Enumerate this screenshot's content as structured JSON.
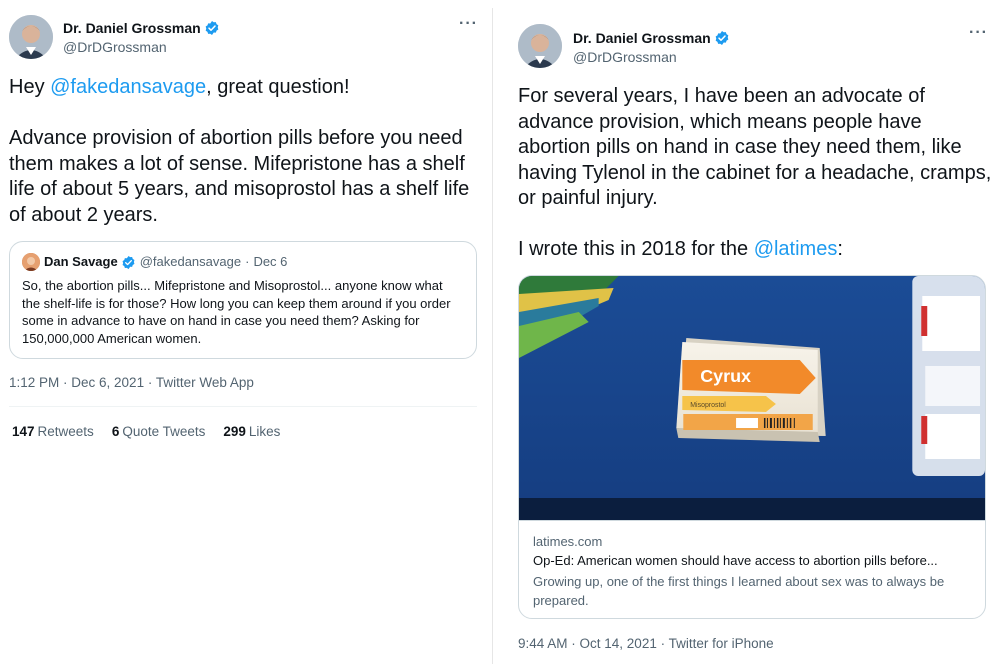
{
  "left_tweet": {
    "author": {
      "display_name": "Dr. Daniel Grossman",
      "handle": "@DrDGrossman",
      "verified": true
    },
    "more_icon": "more-horizontal-icon",
    "text": {
      "greeting": "Hey ",
      "mention": "@fakedansavage",
      "greeting_rest": ", great question!",
      "paragraph": "Advance provision of abortion pills before you need them makes a lot of sense. Mifepristone has a shelf life of about 5 years, and misoprostol has a shelf life of about 2 years."
    },
    "quoted_tweet": {
      "display_name": "Dan Savage",
      "handle": "@fakedansavage",
      "separator": "·",
      "date": "Dec 6",
      "text": "So, the abortion pills... Mifepristone and Misoprostol... anyone know what the shelf-life is for those? How long you can keep them around if you order some in advance to have on hand in case you need them? Asking for 150,000,000 American women."
    },
    "timestamp": "1:12 PM · Dec 6, 2021 · Twitter Web App",
    "stats": {
      "retweets_count": "147",
      "retweets_label": "Retweets",
      "quotes_count": "6",
      "quotes_label": "Quote Tweets",
      "likes_count": "299",
      "likes_label": "Likes"
    }
  },
  "right_tweet": {
    "author": {
      "display_name": "Dr. Daniel Grossman",
      "handle": "@DrDGrossman",
      "verified": true
    },
    "more_icon": "more-horizontal-icon",
    "text": {
      "paragraph1": "For several years, I have been an advocate of advance provision, which means people have abortion pills on hand in case they need them, like having Tylenol in the cabinet for a headache, cramps, or painful injury.",
      "paragraph2_prefix": "I wrote this in 2018 for the ",
      "mention": "@latimes",
      "paragraph2_suffix": ":"
    },
    "link_card": {
      "image_brand": "Cyrux",
      "image_subtext": "Misoprostol",
      "domain": "latimes.com",
      "title": "Op-Ed: American women should have access to abortion pills before...",
      "description": "Growing up, one of the first things I learned about sex was to always be prepared."
    },
    "timestamp": "9:44 AM · Oct 14, 2021 · Twitter for iPhone"
  },
  "colors": {
    "accent": "#1d9bf0",
    "secondary_text": "#536471",
    "border": "#cfd9de"
  }
}
